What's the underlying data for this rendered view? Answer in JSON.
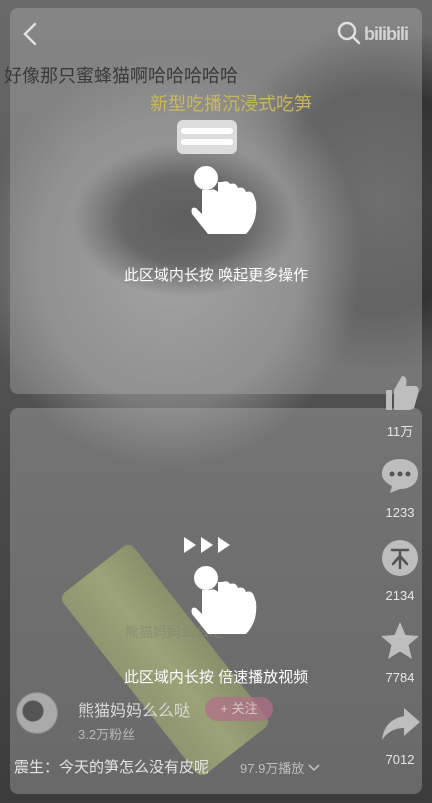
{
  "header": {
    "logo_text": "bilibili",
    "icons": [
      "back-icon",
      "search-icon"
    ]
  },
  "danmaku": [
    "好像那只蜜蜂猫啊哈哈哈哈哈",
    "新型吃播沉浸式吃笋"
  ],
  "gestures": {
    "top_hint": "此区域内长按 唤起更多操作",
    "bottom_hint": "此区域内长按 倍速播放视频"
  },
  "actions": [
    {
      "icon": "thumb-up-icon",
      "count": "11万"
    },
    {
      "icon": "comment-icon",
      "count": "1233"
    },
    {
      "icon": "coin-icon",
      "count": "2134"
    },
    {
      "icon": "star-icon",
      "count": "7784"
    },
    {
      "icon": "share-icon",
      "count": "7012"
    }
  ],
  "author": {
    "name": "熊猫妈妈么么哒",
    "fans": "3.2万粉丝",
    "follow_label": "+ 关注"
  },
  "video": {
    "title": "震生：今天的笋怎么没有皮呢",
    "play_count": "97.9万播放"
  },
  "colors": {
    "overlay": "#b4b4b4",
    "follow_accent": "#fb7299"
  }
}
